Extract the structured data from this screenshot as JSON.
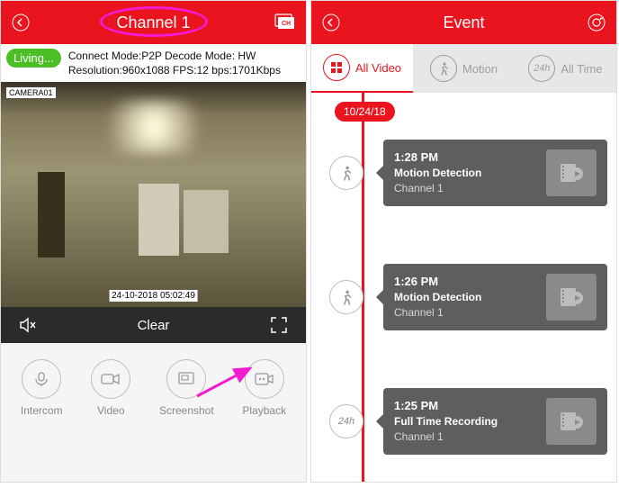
{
  "left": {
    "title": "Channel 1",
    "badge": "Living...",
    "info_line1": "Connect Mode:P2P  Decode Mode: HW",
    "info_line2": "Resolution:960x1088   FPS:12  bps:1701Kbps",
    "camera_tag": "CAMERA01",
    "timestamp": "24-10-2018 05:02:49",
    "clear_label": "Clear",
    "toolbar": {
      "intercom": "Intercom",
      "video": "Video",
      "screenshot": "Screenshot",
      "playback": "Playback"
    }
  },
  "right": {
    "title": "Event",
    "tabs": {
      "all_video": "All Video",
      "motion": "Motion",
      "all_time": "All Time",
      "all_time_icon": "24h"
    },
    "date": "10/24/18",
    "events": [
      {
        "time": "1:28 PM",
        "type": "Motion Detection",
        "channel": "Channel 1",
        "icon": "motion"
      },
      {
        "time": "1:26 PM",
        "type": "Motion Detection",
        "channel": "Channel 1",
        "icon": "motion"
      },
      {
        "time": "1:25 PM",
        "type": "Full Time Recording",
        "channel": "Channel 1",
        "icon": "24h"
      }
    ]
  }
}
